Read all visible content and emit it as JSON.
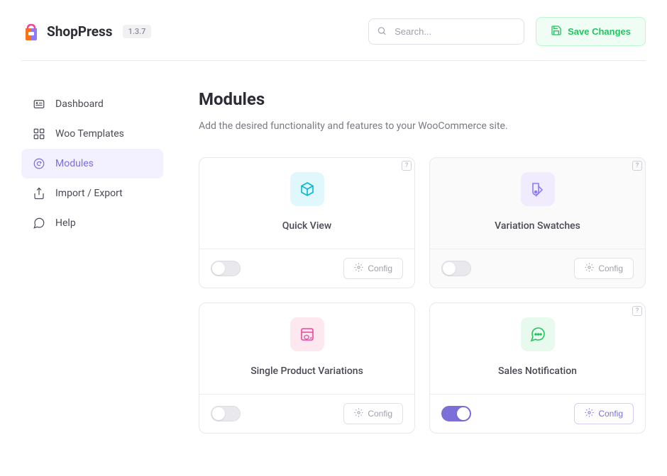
{
  "app": {
    "name": "ShopPress",
    "version": "1.3.7"
  },
  "header": {
    "search_placeholder": "Search...",
    "save_label": "Save Changes"
  },
  "sidebar": {
    "items": [
      {
        "label": "Dashboard",
        "icon": "dashboard"
      },
      {
        "label": "Woo Templates",
        "icon": "templates"
      },
      {
        "label": "Modules",
        "icon": "modules",
        "active": true
      },
      {
        "label": "Import / Export",
        "icon": "import-export"
      },
      {
        "label": "Help",
        "icon": "help"
      }
    ]
  },
  "page": {
    "title": "Modules",
    "description": "Add the desired functionality and features to your WooCommerce site."
  },
  "modules": [
    {
      "title": "Quick View",
      "icon_color": "cyan",
      "enabled": false,
      "config_label": "Config",
      "help": "?"
    },
    {
      "title": "Variation Swatches",
      "icon_color": "purple",
      "enabled": false,
      "config_label": "Config",
      "help": "?"
    },
    {
      "title": "Single Product Variations",
      "icon_color": "pink",
      "enabled": false,
      "config_label": "Config",
      "help": "?"
    },
    {
      "title": "Sales Notification",
      "icon_color": "green",
      "enabled": true,
      "config_label": "Config",
      "help": "?"
    }
  ]
}
